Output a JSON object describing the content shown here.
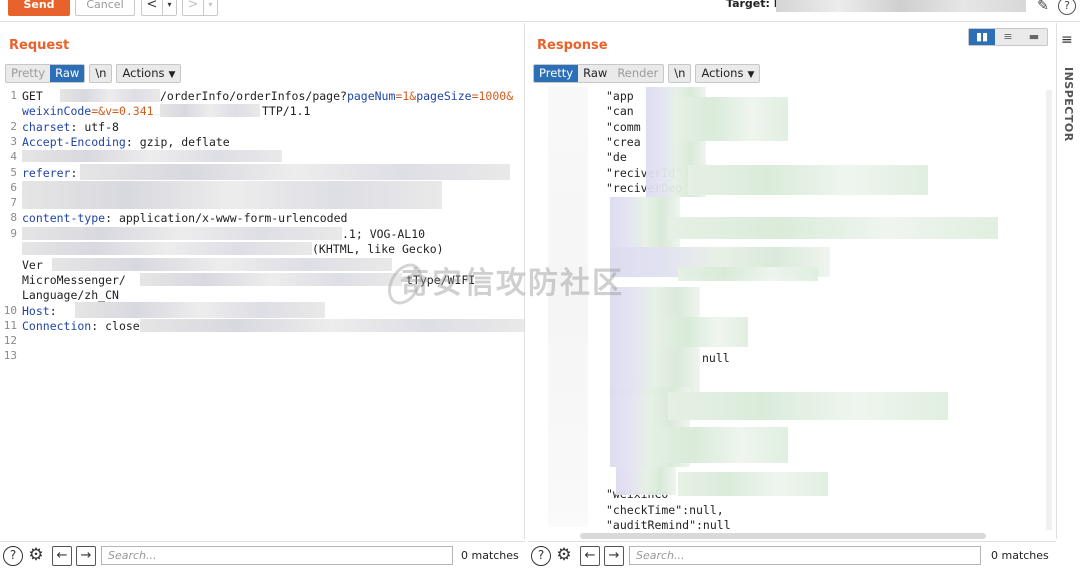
{
  "toolbar": {
    "send_label": "Send",
    "cancel_label": "Cancel",
    "back_glyph": "<",
    "forward_glyph": ">",
    "dropdown_glyph": "▾",
    "target_label": "Target: I",
    "edit_icon": "pencil-icon",
    "help_icon": "?"
  },
  "request": {
    "title": "Request",
    "tabs": {
      "pretty": "Pretty",
      "raw": "Raw",
      "newline": "\\n",
      "actions": "Actions"
    },
    "line_numbers": [
      "1",
      "",
      "2",
      "3",
      "4",
      "5",
      "6",
      "7",
      "8",
      "9",
      "",
      "",
      "",
      "",
      "10",
      "11",
      "12",
      "13"
    ],
    "lines": {
      "l1_method": "GET ",
      "l1_path": "/orderInfo/orderInfos/page?",
      "l1_p1k": "pageNum",
      "l1_p1v": "=1&",
      "l1_p2k": "pageSize",
      "l1_p2v": "=1000&",
      "l1b_k": "weixinCode",
      "l1b_v": "=&v=",
      "l1b_num": "0.341",
      "l1b_proto": "TTP/1.1",
      "l2_k": "charset",
      "l2_v": ": utf-8",
      "l3_k": "Accept-Encoding",
      "l3_v": ": gzip, deflate",
      "l5_k": "referer",
      "l5_v": ":",
      "l8_k": "content-type",
      "l8_v": ": application/x-www-form-urlencoded",
      "l9_frag1": ".1; VOG-AL10",
      "l9_frag2": "(KHTML, like Gecko)",
      "l9b": "Ver",
      "l9c_1": "MicroMessenger/",
      "l9c_2": "tType/WIFI",
      "l9d": "Language/zh_CN",
      "l10_k": "Host",
      "l10_v": ":",
      "l11_k": "Connection",
      "l11_v": ": close"
    }
  },
  "response": {
    "title": "Response",
    "tabs": {
      "pretty": "Pretty",
      "raw": "Raw",
      "render": "Render",
      "newline": "\\n",
      "actions": "Actions"
    },
    "lines": {
      "r1": "\"app",
      "r2": "\"can",
      "r3": "\"comm",
      "r4": "\"crea",
      "r5": "\"de",
      "r6": "\"reciverId\"",
      "r7": "\"reciverDep",
      "r_null": "null",
      "r_tail1": "\"weixinCo",
      "r_check": "\"checkTime\":null,",
      "r_audit": "\"auditRemind\":null"
    }
  },
  "inspector": {
    "label": "INSPECTOR"
  },
  "layout_toggle": [
    "▮▮",
    "≡",
    "▬"
  ],
  "bottom_left": {
    "search_placeholder": "Search...",
    "matches": "0 matches"
  },
  "bottom_right": {
    "search_placeholder": "Search...",
    "matches": "0 matches"
  },
  "watermark": "奇安信攻防社区",
  "colors": {
    "accent": "#e8632b",
    "tab_active": "#2d6fb7",
    "key_blue": "#2045a8",
    "value_orange": "#d25c1e"
  }
}
